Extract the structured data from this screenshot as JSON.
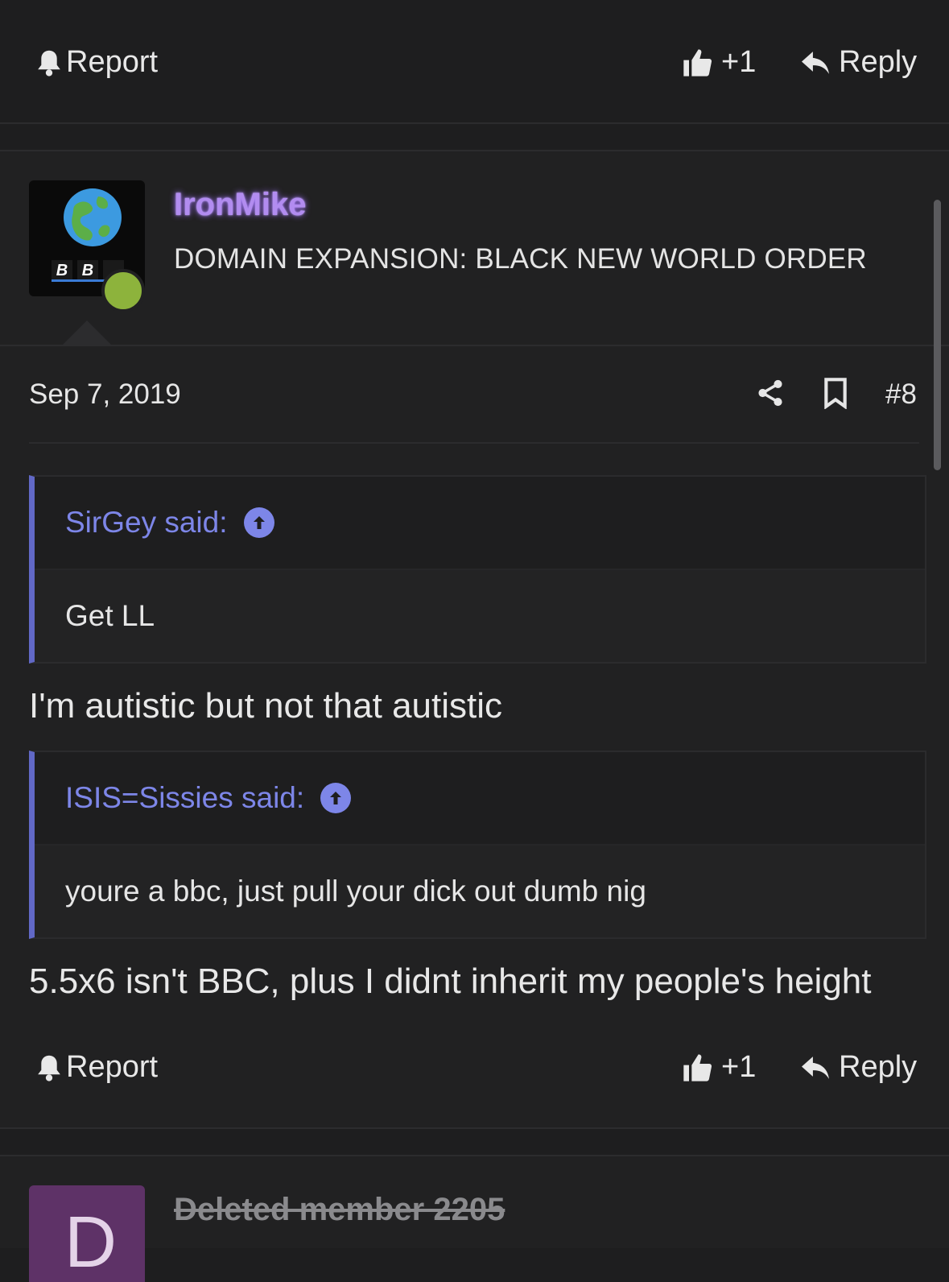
{
  "top_actions": {
    "report": "Report",
    "react_count": "+1",
    "reply": "Reply"
  },
  "post": {
    "username": "IronMike",
    "user_title": "DOMAIN EXPANSION: BLACK NEW WORLD ORDER",
    "avatar_text": "B B C",
    "date": "Sep 7, 2019",
    "post_number": "#8",
    "quotes": [
      {
        "author": "SirGey said:",
        "text": "Get LL"
      },
      {
        "author": "ISIS=Sissies said:",
        "text": "youre a bbc, just pull your dick out dumb nig"
      }
    ],
    "body": [
      "I'm autistic but not that autistic",
      "5.5x6 isn't BBC, plus I didnt inherit my people's height"
    ],
    "actions": {
      "report": "Report",
      "react_count": "+1",
      "reply": "Reply"
    }
  },
  "next_post": {
    "avatar_letter": "D",
    "username": "Deleted member 2205"
  },
  "colors": {
    "background": "#1e1e1f",
    "quote_accent": "#6168c6",
    "username": "#b28cf0",
    "online": "#8db33c"
  }
}
